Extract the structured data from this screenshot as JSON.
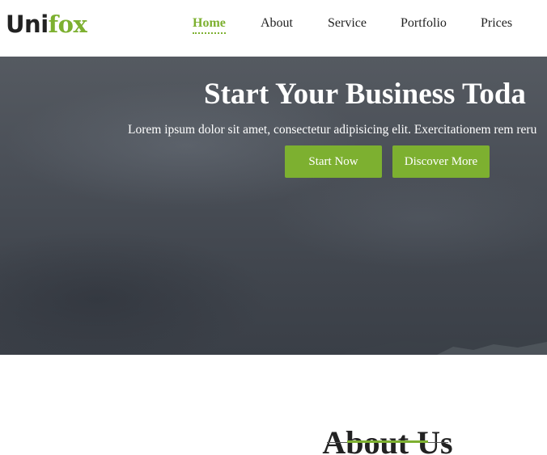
{
  "brand": {
    "part1": "Uni",
    "part2": "fox"
  },
  "nav": {
    "items": [
      {
        "label": "Home",
        "active": true
      },
      {
        "label": "About",
        "active": false
      },
      {
        "label": "Service",
        "active": false
      },
      {
        "label": "Portfolio",
        "active": false
      },
      {
        "label": "Prices",
        "active": false
      }
    ]
  },
  "hero": {
    "title": "Start Your Business Toda",
    "subtitle": "Lorem ipsum dolor sit amet, consectetur adipisicing elit. Exercitationem rem reru",
    "buttons": {
      "start": "Start Now",
      "discover": "Discover More"
    }
  },
  "about": {
    "title": "About Us"
  },
  "colors": {
    "accent": "#7db030",
    "text_dark": "#222222",
    "hero_bg": "#4b5058"
  }
}
